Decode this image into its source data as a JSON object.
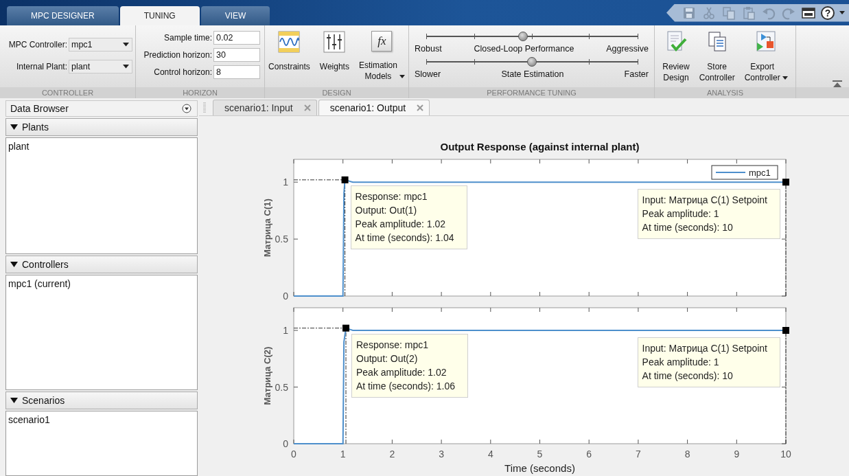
{
  "ribbon_tabs": [
    {
      "label": "MPC DESIGNER",
      "selected": false
    },
    {
      "label": "TUNING",
      "selected": true
    },
    {
      "label": "VIEW",
      "selected": false
    }
  ],
  "quick_access": [
    {
      "kind": "save",
      "disabled": true
    },
    {
      "kind": "cut",
      "disabled": true
    },
    {
      "kind": "copy",
      "disabled": true
    },
    {
      "kind": "paste",
      "disabled": true
    },
    {
      "kind": "undo",
      "disabled": true
    },
    {
      "kind": "redo",
      "disabled": true
    },
    {
      "kind": "windows",
      "disabled": false
    },
    {
      "kind": "help",
      "disabled": false,
      "glyph": "?"
    }
  ],
  "toolstrip": [
    {
      "kind": "dropdowns",
      "title": "CONTROLLER",
      "fields": [
        {
          "label": "MPC Controller:",
          "value": "mpc1"
        },
        {
          "label": "Internal Plant:",
          "value": "plant"
        }
      ]
    },
    {
      "kind": "inputs",
      "title": "HORIZON",
      "fields": [
        {
          "label": "Sample time:",
          "value": "0.02"
        },
        {
          "label": "Prediction horizon:",
          "value": "30"
        },
        {
          "label": "Control horizon:",
          "value": "8"
        }
      ]
    },
    {
      "kind": "buttons",
      "title": "DESIGN",
      "buttons": [
        {
          "kind": "constraints",
          "label": "Constraints",
          "dropdown": false
        },
        {
          "kind": "weights",
          "label": "Weights",
          "dropdown": false
        },
        {
          "kind": "function",
          "glyph": "fx",
          "label": "Estimation Models",
          "dropdown": true
        }
      ]
    },
    {
      "kind": "sliders",
      "title": "PERFORMANCE TUNING",
      "sliders": [
        {
          "left": "Robust",
          "label": "Closed-Loop Performance",
          "right": "Aggressive",
          "level": 0.46
        },
        {
          "left": "Slower",
          "label": "State Estimation",
          "right": "Faster",
          "level": 0.5
        }
      ]
    },
    {
      "kind": "buttons",
      "title": "ANALYSIS",
      "buttons": [
        {
          "kind": "review",
          "label": "Review Design",
          "dropdown": false
        },
        {
          "kind": "store",
          "label": "Store Controller",
          "dropdown": false
        },
        {
          "kind": "export",
          "label": "Export Controller",
          "dropdown": true
        }
      ]
    }
  ],
  "data_browser": {
    "title": "Data Browser",
    "groups": [
      {
        "label": "Plants",
        "expanded": true,
        "items": [
          "plant"
        ]
      },
      {
        "label": "Controllers",
        "expanded": true,
        "items": [
          "mpc1 (current)"
        ]
      },
      {
        "label": "Scenarios",
        "expanded": true,
        "items": [
          "scenario1"
        ]
      }
    ]
  },
  "document_tabs": [
    {
      "label": "scenario1: Input",
      "selected": false
    },
    {
      "label": "scenario1: Output",
      "selected": true
    }
  ],
  "plot": {
    "axes": [
      {
        "chart_data": {
          "type": "line",
          "title": "Output Response (against internal plant)",
          "ylabel": "Матрица C(1)",
          "x": [
            0,
            1,
            1.02,
            1.04,
            1.2,
            10
          ],
          "series": [
            {
              "name": "mpc1",
              "color": "#4d8fcc",
              "values": [
                0,
                0,
                0.9,
                1.02,
                1,
                1
              ]
            }
          ],
          "xlim": [
            0,
            10
          ],
          "ylim": [
            0,
            1.2
          ],
          "yticks": [
            0,
            0.5,
            1
          ],
          "legend": true,
          "ref_lines": [
            {
              "axis": "y",
              "value": 1.02
            },
            {
              "axis": "x",
              "value": 1.04
            },
            {
              "axis": "x",
              "value": 10
            }
          ],
          "annotations": [
            {
              "x": 1.04,
              "y": 1.02,
              "text": "Response: mpc1\nOutput: Out(1)\nPeak amplitude: 1.02\nAt time (seconds): 1.04"
            },
            {
              "x": 10,
              "y": 1,
              "text": "Input: Матрица C(1) Setpoint\nPeak amplitude: 1\nAt time (seconds): 10"
            }
          ]
        }
      },
      {
        "chart_data": {
          "type": "line",
          "xlabel": "Time (seconds)",
          "ylabel": "Матрица C(2)",
          "x": [
            0,
            1,
            1.02,
            1.06,
            1.2,
            10
          ],
          "series": [
            {
              "color": "#4d8fcc",
              "values": [
                0,
                0,
                0.9,
                1.02,
                1,
                1
              ]
            }
          ],
          "xlim": [
            0,
            10
          ],
          "ylim": [
            0,
            1.2
          ],
          "xticks": [
            0,
            1,
            2,
            3,
            4,
            5,
            6,
            7,
            8,
            9,
            10
          ],
          "yticks": [
            0,
            0.5,
            1
          ],
          "ref_lines": [
            {
              "axis": "y",
              "value": 1.02
            },
            {
              "axis": "x",
              "value": 1.06
            },
            {
              "axis": "x",
              "value": 10
            }
          ],
          "annotations": [
            {
              "x": 1.06,
              "y": 1.02,
              "text": "Response: mpc1\nOutput: Out(2)\nPeak amplitude: 1.02\nAt time (seconds): 1.06"
            },
            {
              "x": 10,
              "y": 1,
              "text": "Input: Матрица C(1) Setpoint\nPeak amplitude: 1\nAt time (seconds): 10"
            }
          ]
        }
      }
    ]
  }
}
